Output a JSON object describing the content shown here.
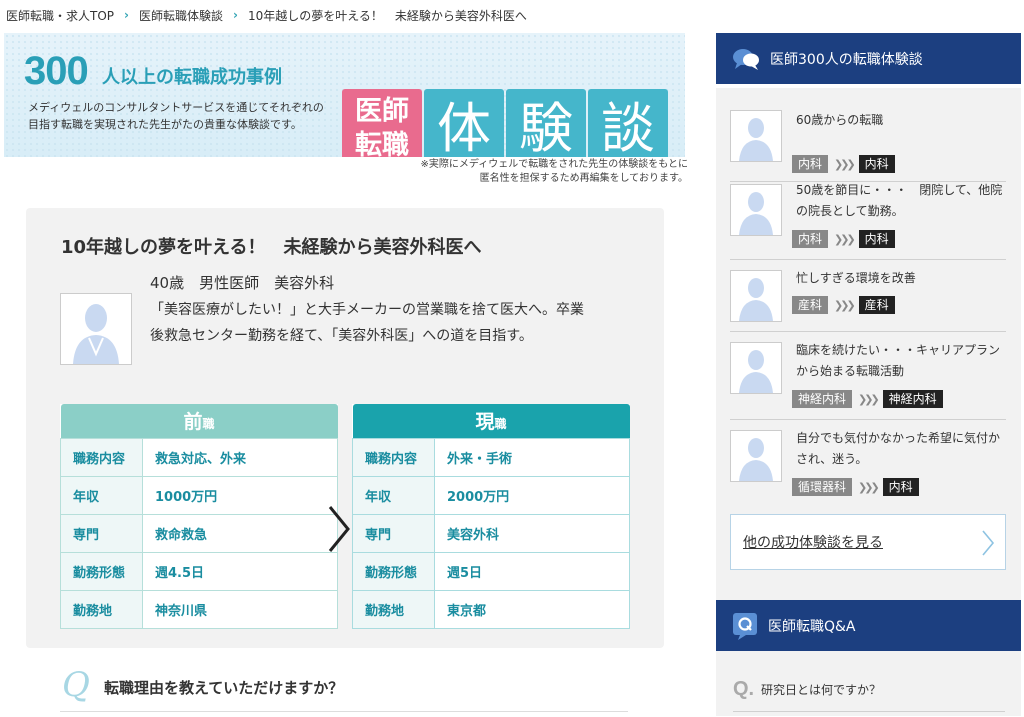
{
  "breadcrumb": {
    "items": [
      "医師転職・求人TOP",
      "医師転職体験談",
      "10年越しの夢を叶える！　未経験から美容外科医へ"
    ],
    "separator": "›"
  },
  "banner": {
    "count": "300",
    "headline": "人以上の転職成功事例",
    "subtext": "メディウェルのコンサルタントサービスを通じてそれぞれの目指す転職を実現された先生がたの貴重な体験談です。",
    "tile_red_line1": "医師",
    "tile_red_line2": "転職",
    "tiles": [
      "体",
      "験",
      "談"
    ],
    "note": "※実際にメディウェルで転職をされた先生の体験談をもとに匿名性を担保するため再編集をしております。"
  },
  "story": {
    "title": "10年越しの夢を叶える！　未経験から美容外科医へ",
    "meta": "40歳　男性医師　美容外科",
    "description": "「美容医療がしたい！」と大手メーカーの営業職を捨て医大へ。卒業後救急センター勤務を経て、「美容外科医」への道を目指す。",
    "before": {
      "head_main": "前",
      "head_small": "職",
      "rows": [
        {
          "label": "職務内容",
          "value": "救急対応、外来"
        },
        {
          "label": "年収",
          "value": "1000万円"
        },
        {
          "label": "専門",
          "value": "救命救急"
        },
        {
          "label": "勤務形態",
          "value": "週4.5日"
        },
        {
          "label": "勤務地",
          "value": "神奈川県"
        }
      ]
    },
    "after": {
      "head_main": "現",
      "head_small": "職",
      "rows": [
        {
          "label": "職務内容",
          "value": "外来・手術"
        },
        {
          "label": "年収",
          "value": "2000万円"
        },
        {
          "label": "専門",
          "value": "美容外科"
        },
        {
          "label": "勤務形態",
          "value": "週5日"
        },
        {
          "label": "勤務地",
          "value": "東京都"
        }
      ]
    },
    "question_mark": "Q",
    "question": "転職理由を教えていただけますか？"
  },
  "sidebar": {
    "stories_title": "医師300人の転職体験談",
    "stories": [
      {
        "text": "60歳からの転職",
        "from": "内科",
        "to": "内科"
      },
      {
        "text": "50歳を節目に・・・　閉院して、他院の院長として勤務。",
        "from": "内科",
        "to": "内科"
      },
      {
        "text": "忙しすぎる環境を改善",
        "from": "産科",
        "to": "産科"
      },
      {
        "text": "臨床を続けたい・・・キャリアプランから始まる転職活動",
        "from": "神経内科",
        "to": "神経内科"
      },
      {
        "text": "自分でも気付かなかった希望に気付かされ、迷う。",
        "from": "循環器科",
        "to": "内科"
      }
    ],
    "more_label": "他の成功体験談を見る",
    "qa_title": "医師転職Q&A",
    "qa_mark": "Q.",
    "qa_first": "研究日とは何ですか？"
  },
  "colors": {
    "navy": "#1c3f80",
    "teal": "#1aa3ac",
    "mint": "#8bcfc7",
    "pink": "#e96b8e",
    "tile_blue": "#45b6cb"
  }
}
